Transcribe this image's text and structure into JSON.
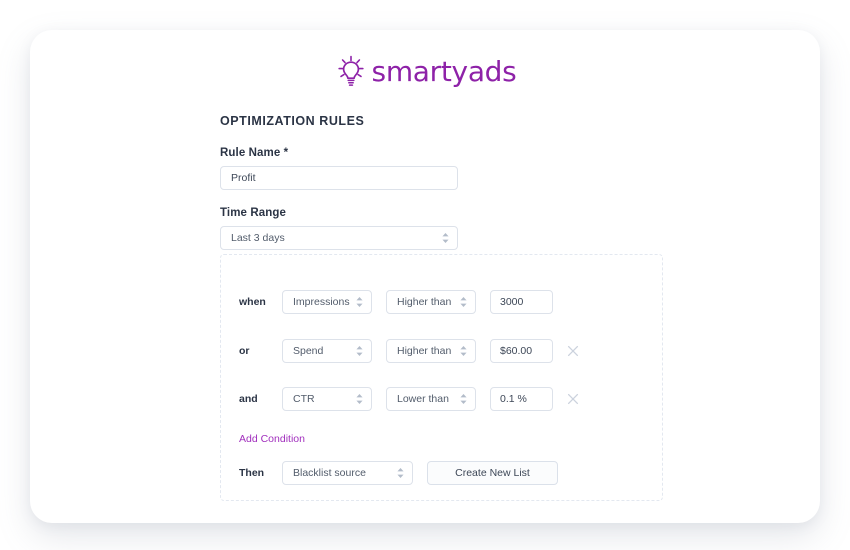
{
  "brand": {
    "name": "smartyads",
    "logo_icon": "lightbulb-icon",
    "accent_color": "#8E22A8",
    "link_color": "#a12fbd"
  },
  "form": {
    "section_title": "OPTIMIZATION RULES",
    "rule_name": {
      "label": "Rule Name *",
      "value": "Profit"
    },
    "time_range": {
      "label": "Time Range",
      "value": "Last 3 days",
      "icon": "chevron-updown-icon"
    }
  },
  "conditions": {
    "rows": [
      {
        "conjunction": "when",
        "metric": "Impressions",
        "operator": "Higher than",
        "value": "3000",
        "removable": false,
        "remove_icon": "close-icon"
      },
      {
        "conjunction": "or",
        "metric": "Spend",
        "operator": "Higher than",
        "value": "$60.00",
        "removable": true,
        "remove_icon": "close-icon"
      },
      {
        "conjunction": "and",
        "metric": "CTR",
        "operator": "Lower than",
        "value": "0.1 %",
        "removable": true,
        "remove_icon": "close-icon"
      }
    ],
    "add_condition_label": "Add Condition",
    "then": {
      "label": "Then",
      "action": "Blacklist source",
      "button_label": "Create New List"
    }
  }
}
